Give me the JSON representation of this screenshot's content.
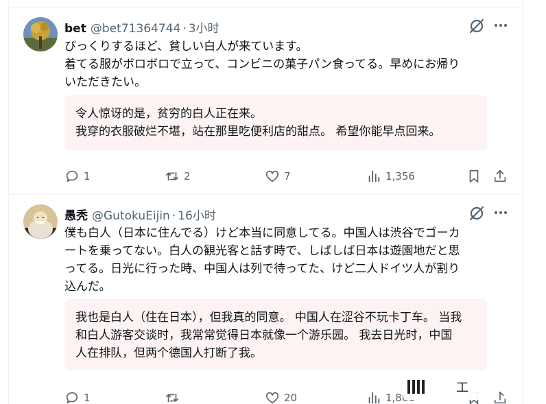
{
  "posts": [
    {
      "name": "bet",
      "handle": "@bet71364744",
      "separator": "·",
      "time": "3小时",
      "lines": [
        "びっくりするほど、貧しい白人が来ています。",
        "着てる服がボロボロで立って、コンビニの菓子パン食ってる。早めにお帰り",
        "いただきたい。"
      ],
      "translation_lines": [
        "令人惊讶的是，贫穷的白人正在来。",
        "我穿的衣服破烂不堪，站在那里吃便利店的甜点。 希望你能早点回来。"
      ],
      "replies": "1",
      "reposts": "2",
      "likes": "7",
      "views": "1,356"
    },
    {
      "name": "愚秃",
      "handle": "@GutokuEijin",
      "separator": "·",
      "time": "16小时",
      "lines": [
        "僕も白人（日本に住んでる）けど本当に同意してる。中国人は渋谷でゴーカ",
        "ートを乗ってない。白人の観光客と話す時で、しばしば日本は遊園地だと思",
        "ってる。日光に行った時、中国人は列で待ってた、けど二人ドイツ人が割り",
        "込んだ。"
      ],
      "translation_lines": [
        "我也是白人（住在日本），但我真的同意。 中国人在涩谷不玩卡丁车。 当我",
        "和白人游客交谈时，我常常觉得日本就像一个游乐园。 我去日光时，中国",
        "人在排队，但两个德国人打断了我。"
      ],
      "replies": "1",
      "reposts": "",
      "likes": "20",
      "views": "1,866"
    }
  ],
  "watermark": {
    "text": "工"
  },
  "icons": {
    "reply": "reply-icon",
    "repost": "repost-icon",
    "like": "heart-icon",
    "views": "views-icon",
    "bookmark": "bookmark-icon",
    "share": "share-icon",
    "grok": "grok-icon",
    "more": "more-icon"
  },
  "colors": {
    "muted": "#536471",
    "text": "#0f1419",
    "translation_bg": "#fdf3f3",
    "border": "#eff3f4"
  }
}
